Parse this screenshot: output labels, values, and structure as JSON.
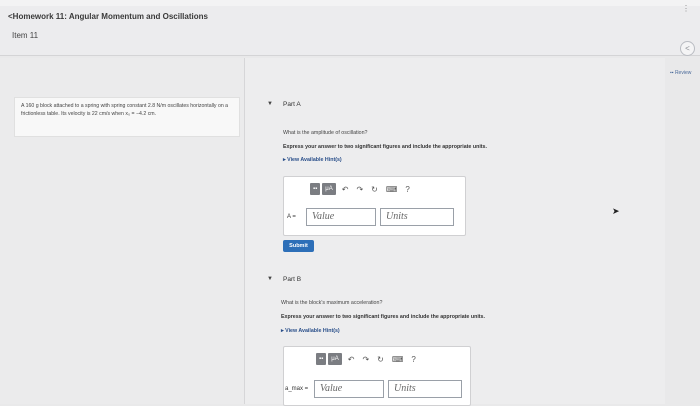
{
  "header": {
    "breadcrumb": "<Homework 11: Angular Momentum and Oscillations",
    "item_title": "Item 11",
    "review_link": "Review",
    "nav_prev": "<"
  },
  "problem": {
    "text": "A 160 g block attached to a spring with spring constant 2.8 N/m oscillates horizontally on a frictionless table. Its velocity is 22 cm/s when x₀ = −4.2 cm."
  },
  "partA": {
    "label": "Part A",
    "question": "What is the amplitude of oscillation?",
    "instruction": "Express your answer to two significant figures and include the appropriate units.",
    "hints": "View Available Hint(s)",
    "symbol": "A =",
    "value_placeholder": "Value",
    "units_placeholder": "Units",
    "submit": "Submit"
  },
  "partB": {
    "label": "Part B",
    "question": "What is the block's maximum acceleration?",
    "instruction": "Express your answer to two significant figures and include the appropriate units.",
    "hints": "View Available Hint(s)",
    "symbol": "a_max =",
    "value_placeholder": "Value",
    "units_placeholder": "Units"
  },
  "toolbar": {
    "template_btn": "▪▪",
    "mu_btn": "μA",
    "undo": "↶",
    "redo": "↷",
    "reset": "↻",
    "keyboard": "⌨",
    "help": "?"
  },
  "colors": {
    "accent": "#2d6fb8",
    "hint_link": "#2a4f8a"
  }
}
